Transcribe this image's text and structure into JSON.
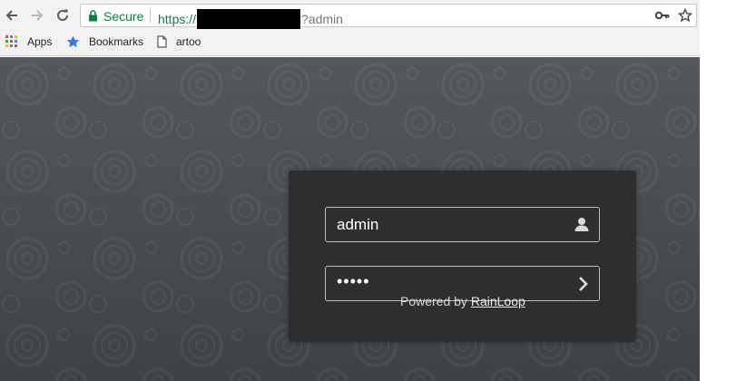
{
  "browser": {
    "address": {
      "secure_label": "Secure",
      "scheme": "https://",
      "suffix": "?admin"
    },
    "bookmarks": {
      "apps_label": "Apps",
      "bookmarks_label": "Bookmarks",
      "artoo_label": "artoo"
    }
  },
  "login": {
    "username": "admin",
    "password_mask": "•••••"
  },
  "footer": {
    "powered_text": "Powered by",
    "powered_link": "RainLoop"
  },
  "colors": {
    "secure": "#0b8043",
    "page_bg": "#4b4e51",
    "panel_bg": "#2c2e30"
  }
}
